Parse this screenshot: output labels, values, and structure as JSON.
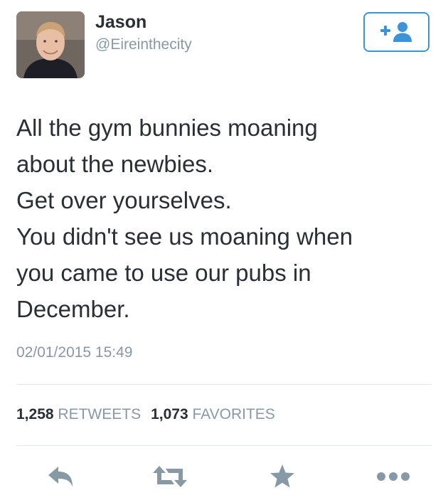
{
  "user": {
    "display_name": "Jason",
    "handle": "@Eireinthecity"
  },
  "follow_button": {
    "icon": "add-user-icon",
    "label": "+"
  },
  "tweet": {
    "lines": [
      "All the gym bunnies moaning",
      "about the newbies.",
      "Get over yourselves.",
      "You didn't see us moaning when",
      "you came to use our pubs in",
      "December."
    ],
    "timestamp": "02/01/2015 15:49"
  },
  "stats": {
    "retweets_count": "1,258",
    "retweets_label": "RETWEETS",
    "favorites_count": "1,073",
    "favorites_label": "FAVORITES"
  },
  "actions": [
    "reply-icon",
    "retweet-icon",
    "favorite-icon",
    "more-icon"
  ],
  "colors": {
    "accent": "#3b94d9",
    "muted": "#8899a6",
    "text": "#292f33",
    "icon": "#8899a6",
    "divider": "#e1e8ed"
  }
}
